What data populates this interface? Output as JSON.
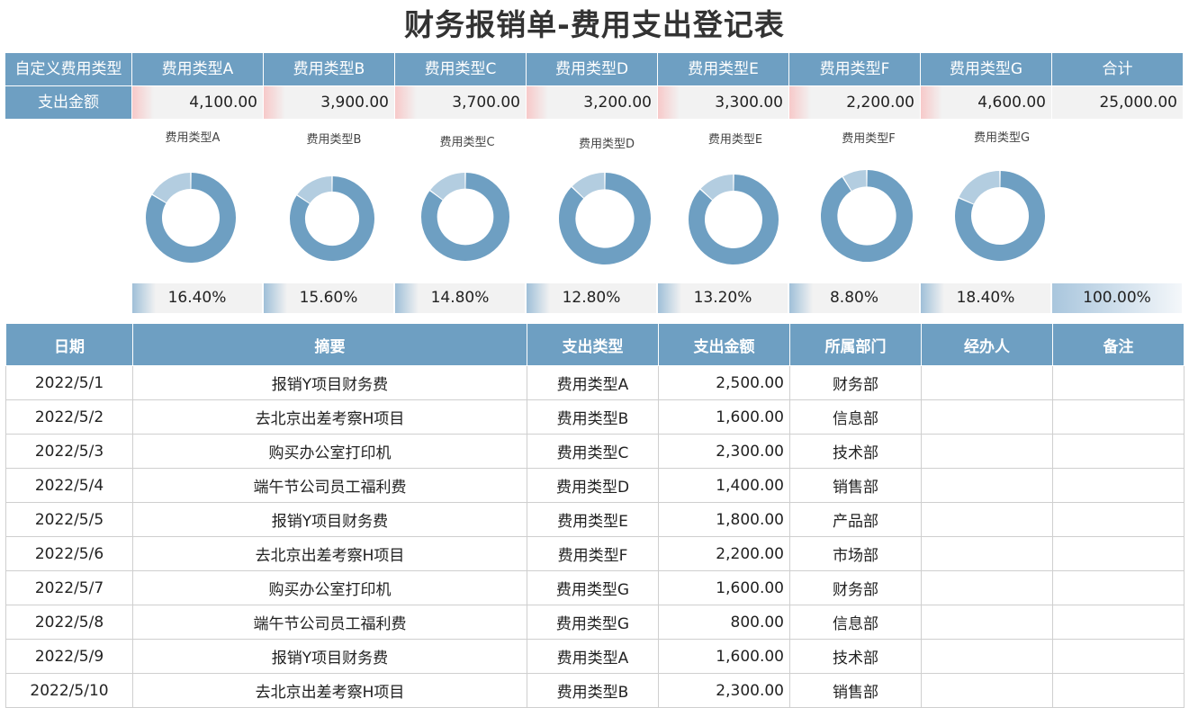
{
  "title": "财务报销单-费用支出登记表",
  "summary": {
    "row1_label": "自定义费用类型",
    "row2_label": "支出金额",
    "categories": [
      "费用类型A",
      "费用类型B",
      "费用类型C",
      "费用类型D",
      "费用类型E",
      "费用类型F",
      "费用类型G"
    ],
    "amounts": [
      "4,100.00",
      "3,900.00",
      "3,700.00",
      "3,200.00",
      "3,300.00",
      "2,200.00",
      "4,600.00"
    ],
    "total_label": "合计",
    "total_amount": "25,000.00",
    "percents": [
      "16.40%",
      "15.60%",
      "14.80%",
      "12.80%",
      "13.20%",
      "8.80%",
      "18.40%"
    ],
    "total_percent": "100.00%"
  },
  "chart_data": {
    "type": "pie",
    "donuts": [
      {
        "title": "费用类型A",
        "value": 16.4
      },
      {
        "title": "费用类型B",
        "value": 15.6
      },
      {
        "title": "费用类型C",
        "value": 14.8
      },
      {
        "title": "费用类型D",
        "value": 12.8
      },
      {
        "title": "费用类型E",
        "value": 13.2
      },
      {
        "title": "费用类型F",
        "value": 8.8
      },
      {
        "title": "费用类型G",
        "value": 18.4
      }
    ],
    "colors": {
      "main": "#6e9fc2",
      "part": "#b3cde0"
    }
  },
  "table": {
    "headers": [
      "日期",
      "摘要",
      "支出类型",
      "支出金额",
      "所属部门",
      "经办人",
      "备注"
    ],
    "rows": [
      [
        "2022/5/1",
        "报销Y项目财务费",
        "费用类型A",
        "2,500.00",
        "财务部",
        "",
        ""
      ],
      [
        "2022/5/2",
        "去北京出差考察H项目",
        "费用类型B",
        "1,600.00",
        "信息部",
        "",
        ""
      ],
      [
        "2022/5/3",
        "购买办公室打印机",
        "费用类型C",
        "2,300.00",
        "技术部",
        "",
        ""
      ],
      [
        "2022/5/4",
        "端午节公司员工福利费",
        "费用类型D",
        "1,400.00",
        "销售部",
        "",
        ""
      ],
      [
        "2022/5/5",
        "报销Y项目财务费",
        "费用类型E",
        "1,800.00",
        "产品部",
        "",
        ""
      ],
      [
        "2022/5/6",
        "去北京出差考察H项目",
        "费用类型F",
        "2,200.00",
        "市场部",
        "",
        ""
      ],
      [
        "2022/5/7",
        "购买办公室打印机",
        "费用类型G",
        "1,600.00",
        "财务部",
        "",
        ""
      ],
      [
        "2022/5/8",
        "端午节公司员工福利费",
        "费用类型G",
        "800.00",
        "信息部",
        "",
        ""
      ],
      [
        "2022/5/9",
        "报销Y项目财务费",
        "费用类型A",
        "1,600.00",
        "技术部",
        "",
        ""
      ],
      [
        "2022/5/10",
        "去北京出差考察H项目",
        "费用类型B",
        "2,300.00",
        "销售部",
        "",
        ""
      ]
    ]
  }
}
